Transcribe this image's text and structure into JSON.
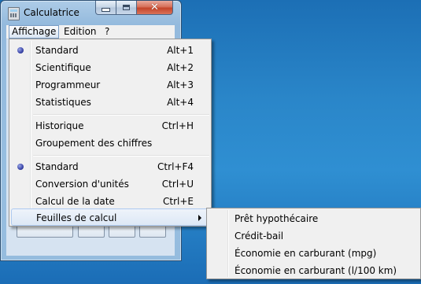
{
  "window": {
    "title": "Calculatrice",
    "icon": "calculator-icon",
    "caption_buttons": {
      "minimize": "minimize-icon",
      "maximize": "maximize-icon",
      "close_glyph": "✕"
    }
  },
  "menubar": {
    "items": [
      "Affichage",
      "Edition",
      "?"
    ]
  },
  "view_menu": {
    "items": [
      {
        "label": "Standard",
        "accel": "Alt+1",
        "checked": true
      },
      {
        "label": "Scientifique",
        "accel": "Alt+2"
      },
      {
        "label": "Programmeur",
        "accel": "Alt+3"
      },
      {
        "label": "Statistiques",
        "accel": "Alt+4"
      },
      {
        "label": "Historique",
        "accel": "Ctrl+H"
      },
      {
        "label": "Groupement des chiffres",
        "accel": ""
      },
      {
        "label": "Standard",
        "accel": "Ctrl+F4",
        "checked": true
      },
      {
        "label": "Conversion d'unités",
        "accel": "Ctrl+U"
      },
      {
        "label": "Calcul de la date",
        "accel": "Ctrl+E"
      },
      {
        "label": "Feuilles de calcul",
        "accel": "",
        "submenu": true,
        "highlighted": true
      }
    ]
  },
  "worksheets_submenu": {
    "items": [
      "Prêt hypothécaire",
      "Crédit-bail",
      "Économie en carburant (mpg)",
      "Économie en carburant (l/100 km)"
    ]
  },
  "colors": {
    "desktop": "#2a86c9",
    "menu_bg": "#f0f0f0",
    "highlight_border": "#aecaf0",
    "close_button": "#c4452a"
  }
}
